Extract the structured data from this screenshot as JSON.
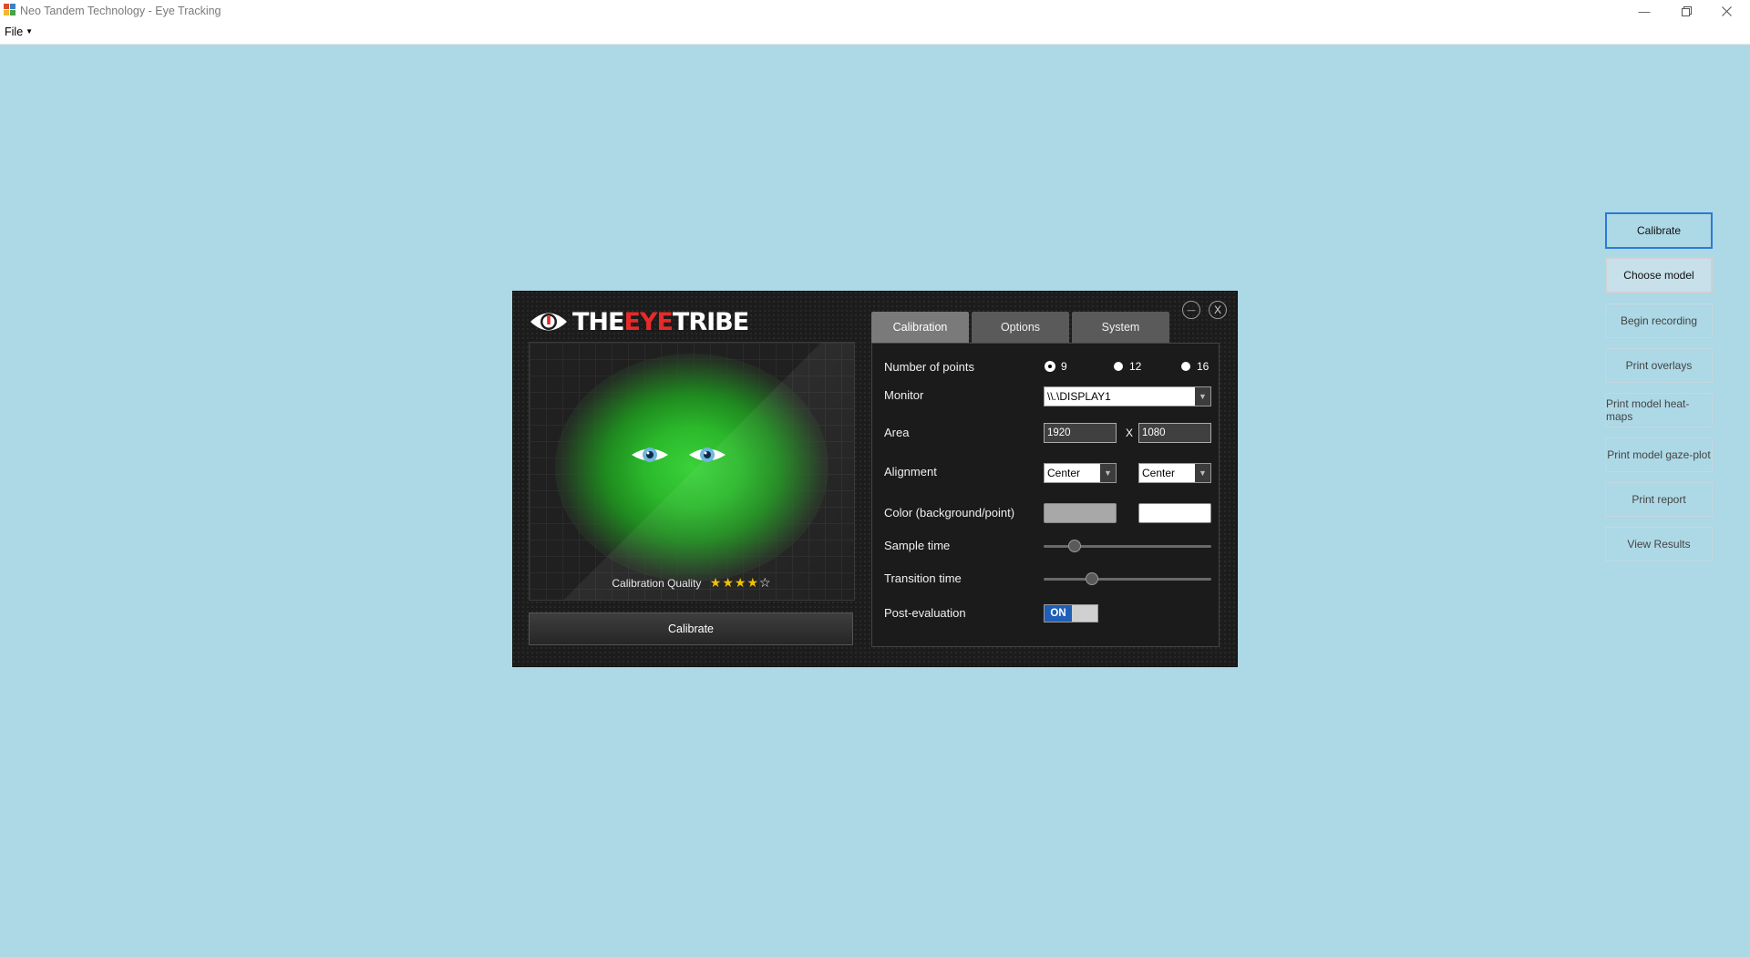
{
  "window": {
    "title": "Neo Tandem Technology - Eye Tracking",
    "menu_file": "File"
  },
  "sidebar": {
    "buttons": [
      {
        "label": "Calibrate"
      },
      {
        "label": "Choose model"
      },
      {
        "label": "Begin recording"
      },
      {
        "label": "Print overlays"
      },
      {
        "label": "Print model heat-maps"
      },
      {
        "label": "Print model gaze-plot"
      },
      {
        "label": "Print report"
      },
      {
        "label": "View Results"
      }
    ]
  },
  "panel": {
    "logo": {
      "part1": "THE",
      "part2": "EYE",
      "part3": "TRIBE"
    },
    "quality_label": "Calibration Quality",
    "quality_stars": 4,
    "quality_max": 5,
    "calibrate_button": "Calibrate",
    "minimize_glyph": "—",
    "close_glyph": "X",
    "tabs": [
      {
        "label": "Calibration",
        "active": true
      },
      {
        "label": "Options",
        "active": false
      },
      {
        "label": "System",
        "active": false
      }
    ],
    "settings": {
      "points_label": "Number of points",
      "points_options": [
        "9",
        "12",
        "16"
      ],
      "points_selected": "9",
      "monitor_label": "Monitor",
      "monitor_value": "\\\\.\\DISPLAY1",
      "area_label": "Area",
      "area_width": "1920",
      "area_sep": "X",
      "area_height": "1080",
      "alignment_label": "Alignment",
      "alignment_h": "Center",
      "alignment_v": "Center",
      "color_label": "Color (background/point)",
      "color_background": "#a8a8a8",
      "color_point": "#ffffff",
      "sample_time_label": "Sample time",
      "sample_time_level": 0.16,
      "transition_time_label": "Transition time",
      "transition_time_level": 0.27,
      "post_eval_label": "Post-evaluation",
      "post_eval_value": "ON"
    }
  },
  "colors": {
    "background": "#add8e6",
    "primary_border": "#2a7bd6",
    "logo_accent": "#e82a2a",
    "glow": "#3ad23a",
    "toggle_on": "#1f5fb8",
    "stars": "#f2c200"
  }
}
